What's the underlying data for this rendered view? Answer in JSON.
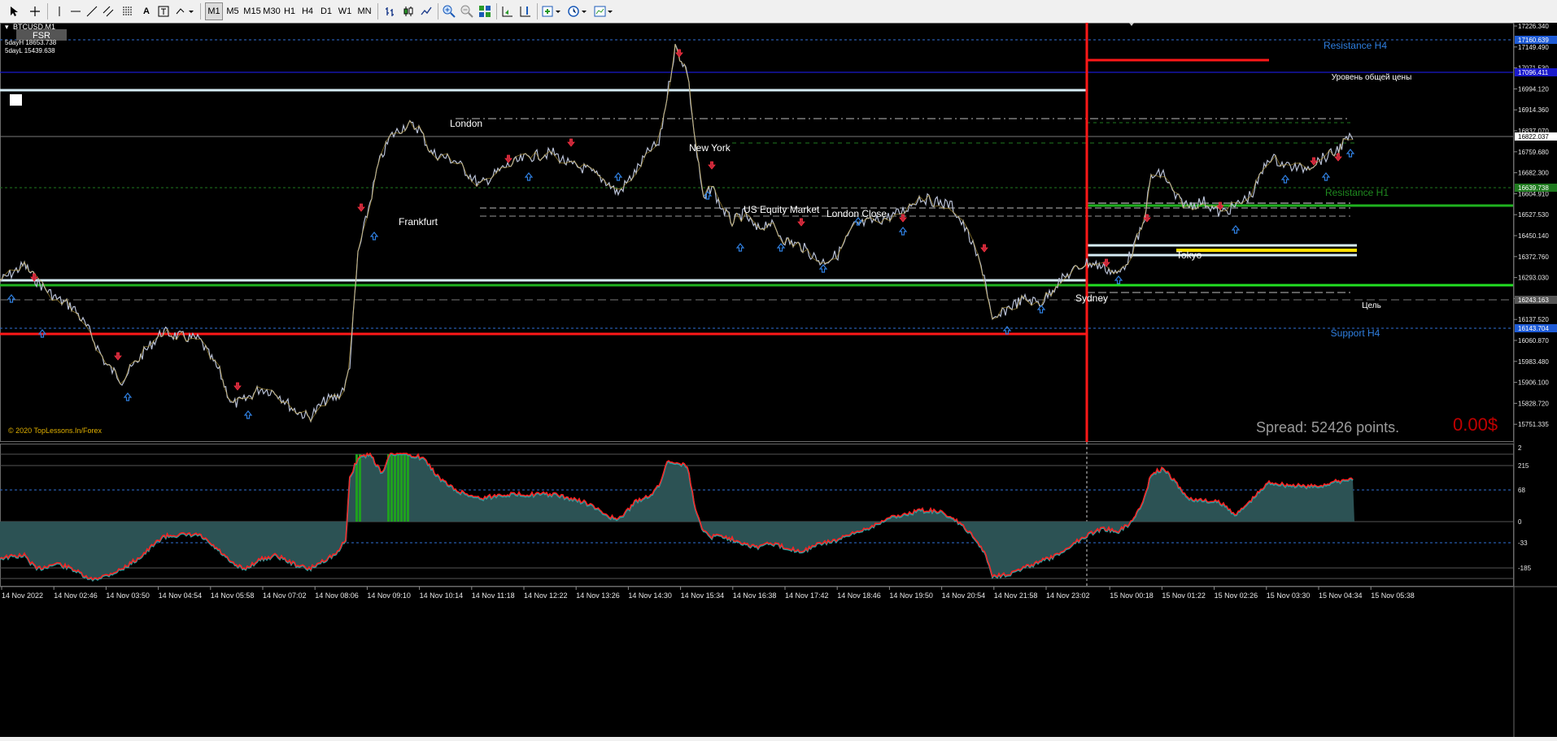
{
  "toolbar": {
    "timeframes": [
      "M1",
      "M5",
      "M15",
      "M30",
      "H1",
      "H4",
      "D1",
      "W1",
      "MN"
    ],
    "active_timeframe": "M1"
  },
  "chart": {
    "symbol_label": "BTCUSD,M1",
    "fsr_label": "FSR",
    "day_high": "5dayH 18653.738",
    "day_low": "5dayL 15439.638",
    "copyright": "© 2020 TopLessons.In/Forex",
    "spread": "Spread: 52426 points.",
    "profit": "0.00$",
    "session_labels": [
      "London",
      "New York",
      "Frankfurt",
      "US Equity Market",
      "London Close",
      "Tokyo",
      "Sydney"
    ],
    "level_labels": {
      "resistance_h4": "Resistance H4",
      "common_price": "Уровень общей цены",
      "resistance_h1": "Resistance H1",
      "target": "Цель",
      "support_h4": "Support H4"
    },
    "price_axis": [
      "17226.340",
      "17149.490",
      "17071.530",
      "16994.120",
      "16914.360",
      "16837.070",
      "16759.680",
      "16682.300",
      "16604.910",
      "16527.530",
      "16450.140",
      "16372.760",
      "16293.030",
      "16215.645",
      "16137.520",
      "16060.870",
      "15983.480",
      "15906.100",
      "15828.720",
      "15751.335"
    ],
    "price_markers": [
      {
        "value": "17160.639",
        "color": "#1e5bd6"
      },
      {
        "value": "17096.411",
        "color": "#1a1acc"
      },
      {
        "value": "16822.037",
        "color": "#ffffff"
      },
      {
        "value": "16639.738",
        "color": "#1f7a1f"
      },
      {
        "value": "16243.163",
        "color": "#555555"
      },
      {
        "value": "16143.704",
        "color": "#1e5bd6"
      }
    ],
    "osc_axis": [
      "2",
      "215",
      "68",
      "0",
      "-33",
      "-185"
    ],
    "time_axis": [
      "14 Nov 2022",
      "14 Nov 02:46",
      "14 Nov 03:50",
      "14 Nov 04:54",
      "14 Nov 05:58",
      "14 Nov 07:02",
      "14 Nov 08:06",
      "14 Nov 09:10",
      "14 Nov 10:14",
      "14 Nov 11:18",
      "14 Nov 12:22",
      "14 Nov 13:26",
      "14 Nov 14:30",
      "14 Nov 15:34",
      "14 Nov 16:38",
      "14 Nov 17:42",
      "14 Nov 18:46",
      "14 Nov 19:50",
      "14 Nov 20:54",
      "14 Nov 21:58",
      "14 Nov 23:02",
      "15 Nov 00:18",
      "15 Nov 01:22",
      "15 Nov 02:26",
      "15 Nov 03:30",
      "15 Nov 04:34",
      "15 Nov 05:38"
    ]
  }
}
